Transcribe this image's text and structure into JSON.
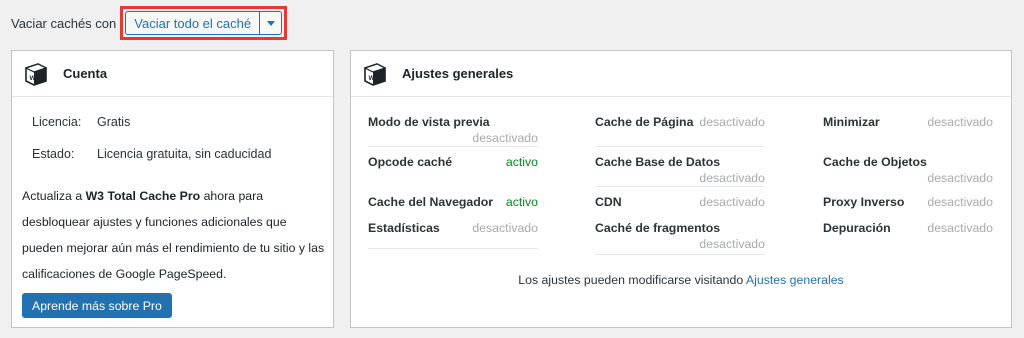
{
  "topbar": {
    "label": "Vaciar cachés con",
    "button_label": "Vaciar todo el caché"
  },
  "license_card": {
    "title": "Cuenta",
    "logo_text": "W3",
    "rows": [
      {
        "key": "Licencia:",
        "value": "Gratis"
      },
      {
        "key": "Estado:",
        "value": "Licencia gratuita, sin caducidad"
      }
    ],
    "promo_prefix": "Actualiza a ",
    "promo_strong": "W3 Total Cache Pro",
    "promo_suffix": " ahora para desbloquear ajustes y funciones adicionales que pueden mejorar aún más el rendimiento de tu sitio y las calificaciones de Google PageSpeed.",
    "button_label": "Aprende más sobre Pro"
  },
  "settings_card": {
    "title": "Ajustes generales",
    "logo_text": "W3",
    "items": [
      {
        "name": "Modo de vista previa",
        "status": "desactivado",
        "active": false
      },
      {
        "name": "Cache de Página",
        "status": "desactivado",
        "active": false
      },
      {
        "name": "Minimizar",
        "status": "desactivado",
        "active": false
      },
      {
        "name": "Opcode caché",
        "status": "activo",
        "active": true
      },
      {
        "name": "Cache Base de Datos",
        "status": "desactivado",
        "active": false
      },
      {
        "name": "Cache de Objetos",
        "status": "desactivado",
        "active": false
      },
      {
        "name": "Cache del Navegador",
        "status": "activo",
        "active": true
      },
      {
        "name": "CDN",
        "status": "desactivado",
        "active": false
      },
      {
        "name": "Proxy Inverso",
        "status": "desactivado",
        "active": false
      },
      {
        "name": "Estadísticas",
        "status": "desactivado",
        "active": false
      },
      {
        "name": "Caché de fragmentos",
        "status": "desactivado",
        "active": false
      },
      {
        "name": "Depuración",
        "status": "desactivado",
        "active": false
      }
    ],
    "footer_text": "Los ajustes pueden modificarse visitando ",
    "footer_link": "Ajustes generales"
  },
  "colors": {
    "accent": "#2271b1",
    "active": "#008a20",
    "inactive": "#a7aaad",
    "highlight": "#e53935"
  }
}
